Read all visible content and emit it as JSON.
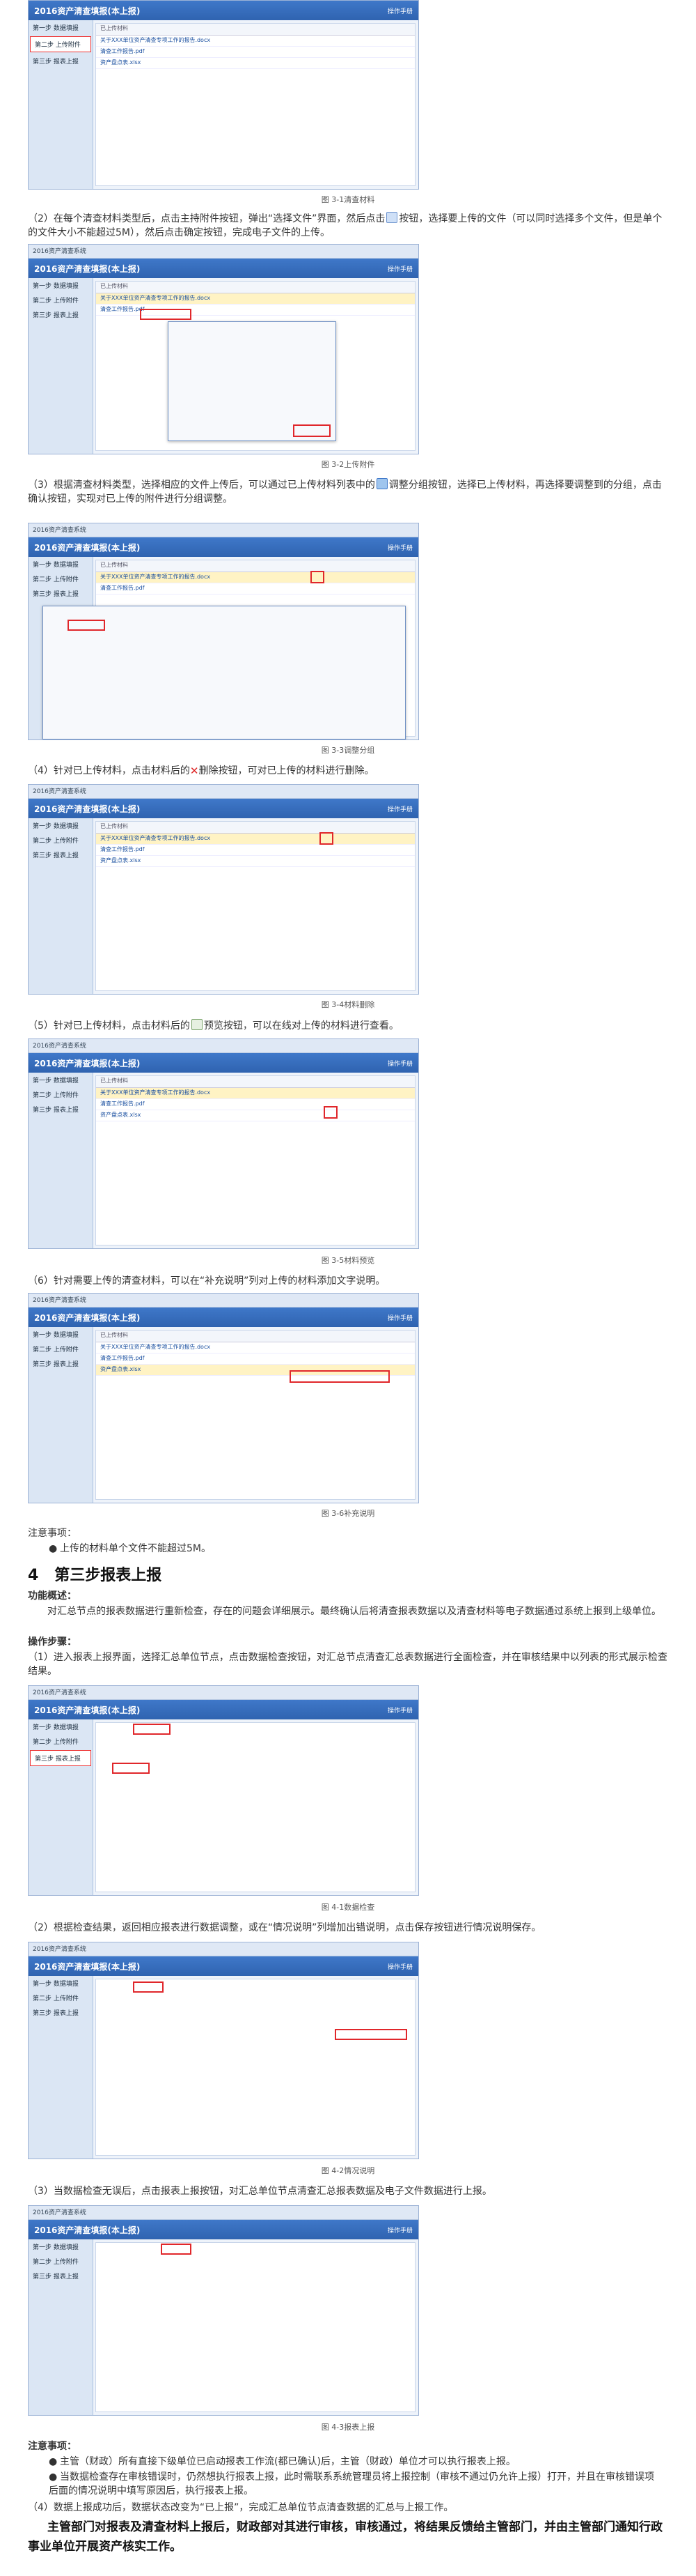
{
  "app": {
    "title": "2016资产清查填报(本上报)",
    "help": "操作手册",
    "topbar": "2016资产清查系统",
    "side_items": [
      "第一步 数据填报",
      "第二步 上传附件",
      "第三步 报表上报"
    ],
    "file_rows": [
      "关于XXX单位资产清查专项工作的报告.docx",
      "清查工作报告.pdf",
      "资产盘点表.xlsx"
    ],
    "col_header": "已上传材料"
  },
  "captions": {
    "c1": "图 3-1清查材料",
    "c2": "图 3-2上传附件",
    "c3": "图 3-3调整分组",
    "c4": "图 3-4材料删除",
    "c5": "图 3-5材料预览",
    "c6": "图 3-6补充说明",
    "c7": "图 4-1数据检查",
    "c8": "图 4-2情况说明",
    "c9": "图 4-3报表上报"
  },
  "paras": {
    "p2": "（2）在每个清查材料类型后，点击主持附件按钮，弹出“选择文件”界面，然后点击",
    "p2b": "按钮，选择要上传的文件（可以同时选择多个文件，但是单个的文件大小不能超过5M），然后点击确定按钮，完成电子文件的上传。",
    "p3": "（3）根据清查材料类型，选择相应的文件上传后，可以通过已上传材料列表中的",
    "p3g": "调整分组",
    "p3b": "按钮，选择已上传材料，再选择要调整到的分组，点击确认按钮，实现对已上传的附件进行分组调整。",
    "p4a": "（4）针对已上传材料，点击材料后的",
    "p4x": "删除",
    "p4b": "按钮，可对已上传的材料进行删除。",
    "p5a": "（5）针对已上传材料，点击材料后的",
    "p5v": "预览",
    "p5b": "按钮，可以在线对上传的材料进行查看。",
    "p6": "（6）针对需要上传的清查材料，可以在“补充说明”列对上传的材料添加文字说明。",
    "note_title": "注意事项：",
    "note1": "上传的材料单个文件不能超过5M。",
    "h4_num": "4",
    "h4": "第三步报表上报",
    "func_title": "功能概述：",
    "func_text": "对汇总节点的报表数据进行重新检查，存在的问题会详细展示。最终确认后将清查报表数据以及清查材料等电子数据通过系统上报到上级单位。",
    "step_title": "操作步骤：",
    "s1": "（1）进入报表上报界面，选择汇总单位节点，点击数据检查按钮，对汇总节点清查汇总表数据进行全面检查，并在审核结果中以列表的形式展示检查结果。",
    "s2": "（2）根据检查结果，返回相应报表进行数据调整，或在“情况说明”列增加出错说明，点击保存按钮进行情况说明保存。",
    "s3": "（3）当数据检查无误后，点击报表上报按钮，对汇总单位节点清查汇总报表数据及电子文件数据进行上报。",
    "note2_title": "注意事项：",
    "n1": "主管（财政）所有直接下级单位已启动报表工作流(都已确认)后，主管（财政）单位才可以执行报表上报。",
    "n2": "当数据检查存在审核错误时，仍然想执行报表上报，此时需联系系统管理员将上报控制（审核不通过仍允许上报）打开，并且在审核错误项后面的情况说明中填写原因后，执行报表上报。",
    "n3": "（4）数据上报成功后，数据状态改变为“已上报”，完成汇总单位节点清查数据的汇总与上报工作。",
    "final": "主管部门对报表及清查材料上报后，财政部对其进行审核，审核通过，将结果反馈给主管部门，并由主管部门通知行政事业单位开展资产核实工作。"
  }
}
